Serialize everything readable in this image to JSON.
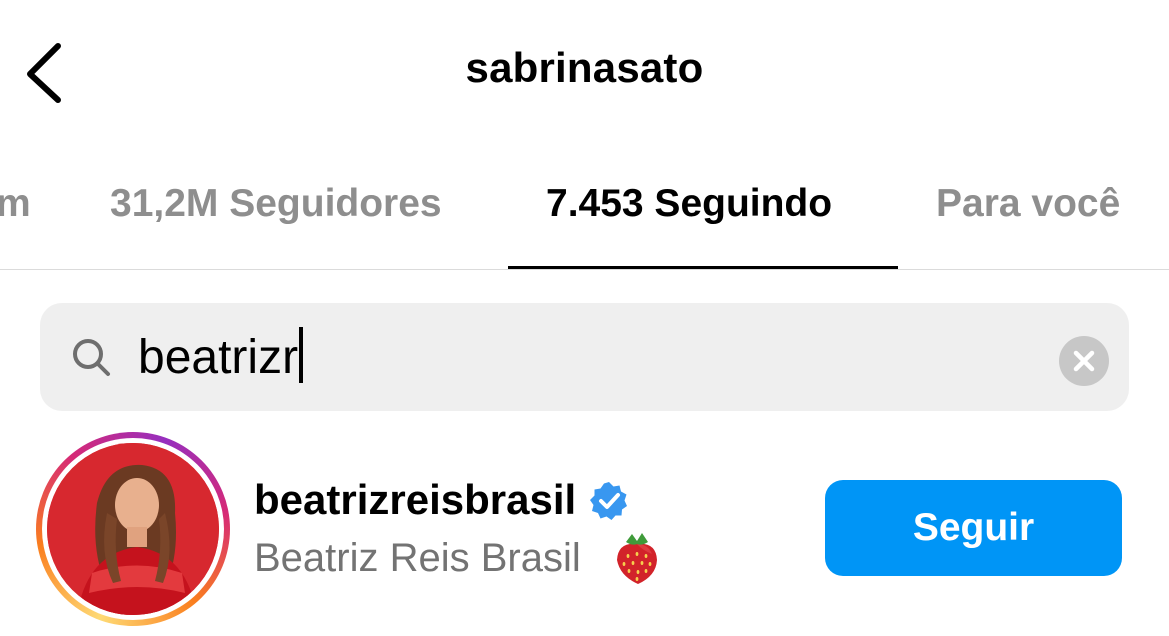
{
  "header": {
    "title": "sabrinasato",
    "back_icon": "chevron-left-icon"
  },
  "tabs": [
    {
      "label": "m",
      "active": false
    },
    {
      "label": "31,2M Seguidores",
      "active": false
    },
    {
      "label": "7.453 Seguindo",
      "active": true
    },
    {
      "label": "Para você",
      "active": false
    }
  ],
  "search": {
    "value": "beatrizr",
    "icon": "search-icon",
    "clear_icon": "clear-icon"
  },
  "results": [
    {
      "username": "beatrizreisbrasil",
      "verified": true,
      "full_name": "Beatriz Reis Brasil",
      "emoji": "strawberry",
      "has_story_ring": true,
      "action_label": "Seguir"
    }
  ],
  "colors": {
    "accent": "#0095f6",
    "secondary_text": "#737373",
    "inactive_tab": "#8e8e8e",
    "search_bg": "#efefef",
    "verified": "#3897f0"
  }
}
